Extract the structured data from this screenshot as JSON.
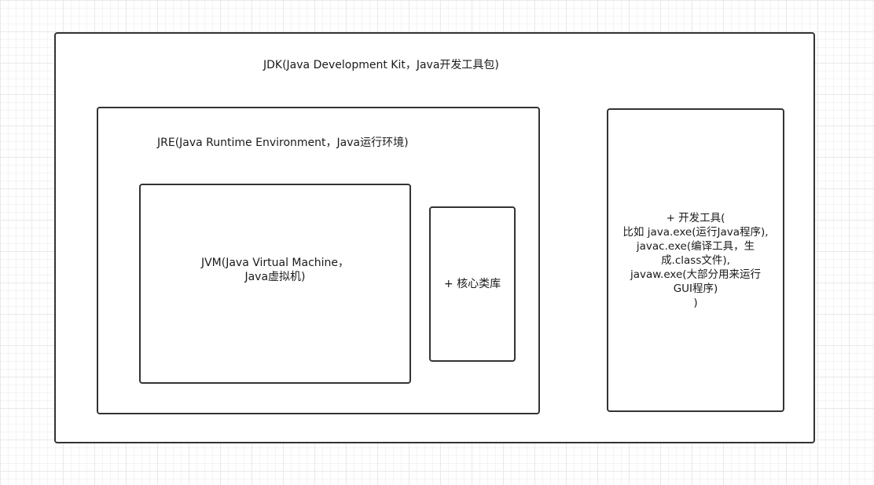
{
  "diagram": {
    "jdk": {
      "label": "JDK(Java Development Kit，Java开发工具包)"
    },
    "jre": {
      "label": "JRE(Java Runtime Environment，Java运行环境)"
    },
    "jvm": {
      "lines": [
        "JVM(Java Virtual  Machine，",
        "Java虚拟机)"
      ]
    },
    "core_libs": {
      "label": "+ 核心类库"
    },
    "dev_tools": {
      "lines": [
        "+ 开发工具(",
        "比如 java.exe(运行Java程序),",
        "javac.exe(编译工具，生",
        "成.class文件),",
        "javaw.exe(大部分用来运行",
        "GUI程序)",
        ")"
      ]
    }
  }
}
